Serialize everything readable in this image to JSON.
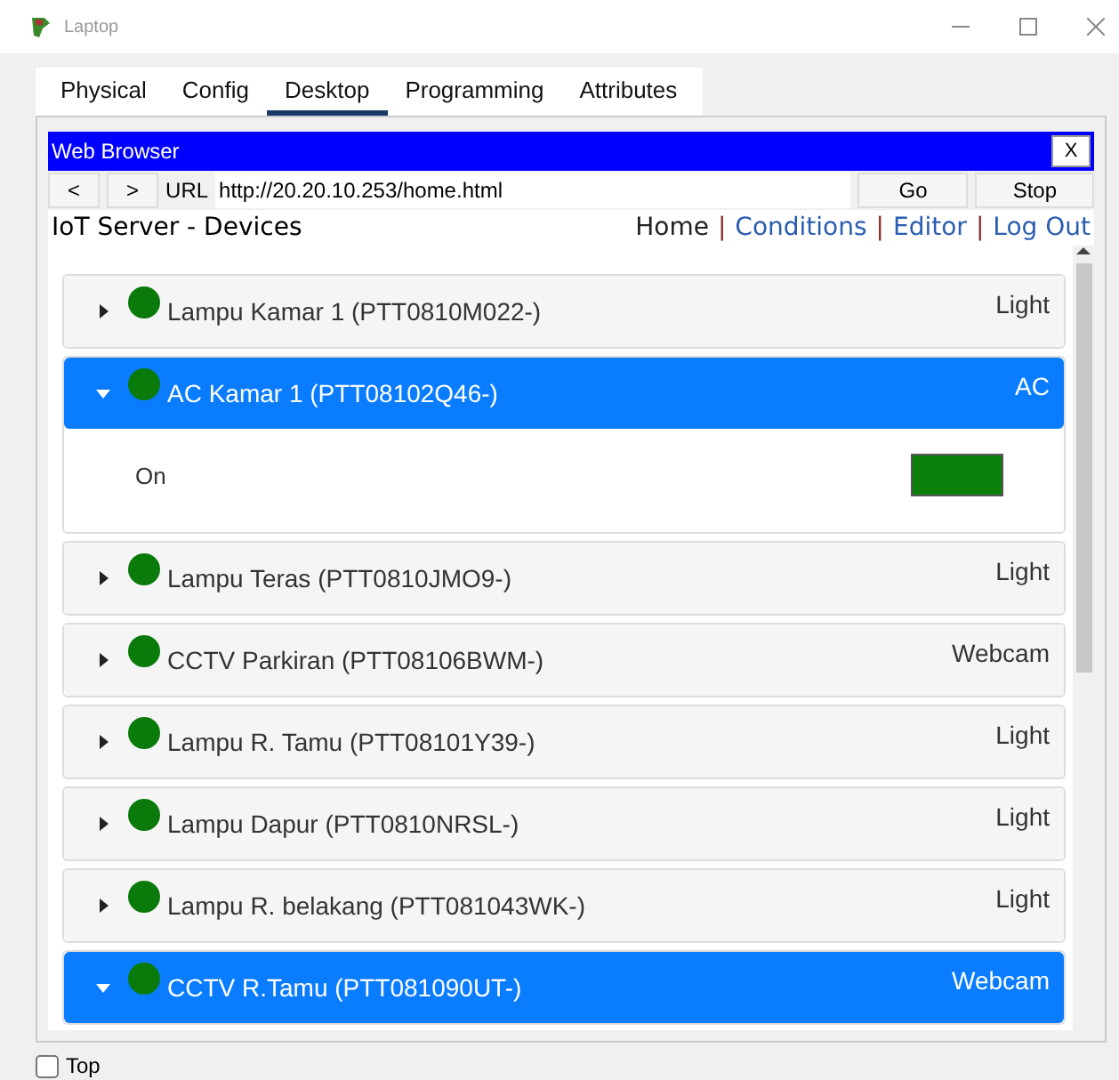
{
  "window": {
    "title": "Laptop"
  },
  "tabs": [
    {
      "label": "Physical",
      "selected": false
    },
    {
      "label": "Config",
      "selected": false
    },
    {
      "label": "Desktop",
      "selected": true
    },
    {
      "label": "Programming",
      "selected": false
    },
    {
      "label": "Attributes",
      "selected": false
    }
  ],
  "browser": {
    "title": "Web Browser",
    "close": "X",
    "back": "<",
    "forward": ">",
    "url_label": "URL",
    "url": "http://20.20.10.253/home.html",
    "go": "Go",
    "stop": "Stop"
  },
  "page": {
    "title": "IoT Server - Devices",
    "nav": [
      {
        "label": "Home",
        "kind": "plain"
      },
      {
        "separator": "|",
        "label": "Conditions",
        "kind": "link"
      },
      {
        "separator": "|",
        "label": "Editor",
        "kind": "link"
      },
      {
        "separator": "|",
        "label": "Log Out",
        "kind": "link"
      }
    ]
  },
  "devices": [
    {
      "name": "Lampu Kamar 1 (PTT0810M022-)",
      "type": "Light",
      "expanded": false,
      "color": "#0a7a0a"
    },
    {
      "name": "AC Kamar 1 (PTT08102Q46-)",
      "type": "AC",
      "expanded": true,
      "color": "#0a7a0a",
      "details": [
        {
          "label": "On",
          "on": true
        }
      ]
    },
    {
      "name": "Lampu Teras (PTT0810JMO9-)",
      "type": "Light",
      "expanded": false,
      "color": "#0a7a0a"
    },
    {
      "name": "CCTV Parkiran (PTT08106BWM-)",
      "type": "Webcam",
      "expanded": false,
      "color": "#0a7a0a"
    },
    {
      "name": "Lampu R. Tamu (PTT08101Y39-)",
      "type": "Light",
      "expanded": false,
      "color": "#0a7a0a"
    },
    {
      "name": "Lampu Dapur (PTT0810NRSL-)",
      "type": "Light",
      "expanded": false,
      "color": "#0a7a0a"
    },
    {
      "name": "Lampu R. belakang (PTT081043WK-)",
      "type": "Light",
      "expanded": false,
      "color": "#0a7a0a"
    },
    {
      "name": "CCTV R.Tamu (PTT081090UT-)",
      "type": "Webcam",
      "expanded": true,
      "color": "#0a7a0a"
    }
  ],
  "footer": {
    "label": "Top",
    "checked": false
  }
}
